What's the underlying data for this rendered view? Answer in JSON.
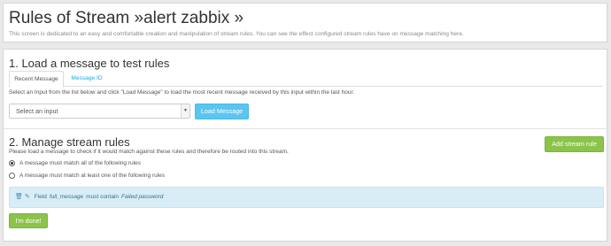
{
  "header": {
    "title": "Rules of Stream »alert zabbix »",
    "description": "This screen is dedicated to an easy and comfortable creation and manipulation of stream rules. You can see the effect configured stream rules have on message matching here."
  },
  "load_section": {
    "title": "1. Load a message to test rules",
    "tabs": [
      {
        "label": "Recent Message",
        "active": true
      },
      {
        "label": "Message ID",
        "active": false
      }
    ],
    "hint": "Select an Input from the list below and click \"Load Message\" to load the most recent message received by this input within the last hour.",
    "select": {
      "value": "Select an input"
    },
    "load_button": "Load Message"
  },
  "rules_section": {
    "title": "2. Manage stream rules",
    "description": "Please load a message to check if it would match against these rules and therefore be routed into this stream.",
    "add_button": "Add stream rule",
    "match_options": [
      {
        "label": "A message must match all of the following rules",
        "checked": true
      },
      {
        "label": "A message must match at least one of the following rules",
        "checked": false
      }
    ],
    "rule": {
      "prefix": "Field",
      "field": "full_message",
      "operator": "must contain",
      "value": "Failed password",
      "delete_icon": "trash-icon",
      "edit_icon": "edit-icon"
    },
    "done_button": "I'm done!"
  },
  "colors": {
    "info_button": "#5bc5f0",
    "success_button": "#8cc34b",
    "rule_box_bg": "#d9edf7",
    "tab_link": "#16ace3"
  }
}
